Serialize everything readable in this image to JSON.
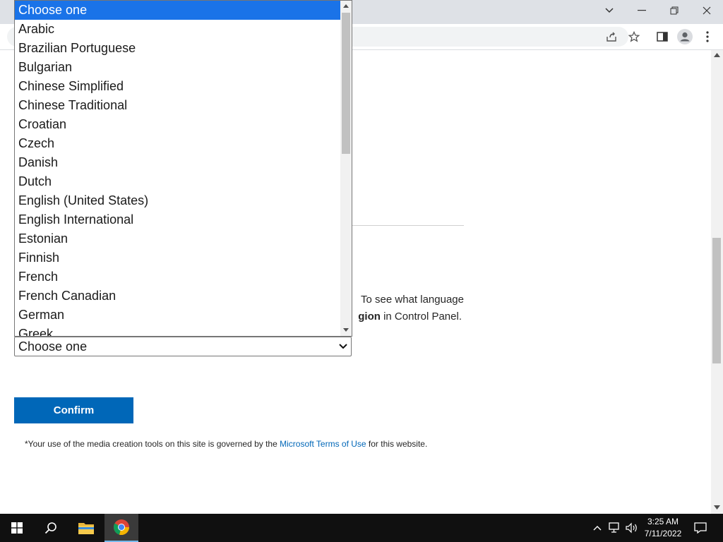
{
  "browser": {
    "window_controls": [
      "chevron-down",
      "minimize",
      "restore",
      "close"
    ]
  },
  "page": {
    "info_line1": "To see what language",
    "info_line2_bold": "gion",
    "info_line2_rest": " in Control Panel.",
    "select_value": "Choose one",
    "confirm_label": "Confirm",
    "terms_prefix": "*Your use of the media creation tools on this site is governed by the ",
    "terms_link": "Microsoft Terms of Use",
    "terms_suffix": " for this website."
  },
  "dropdown": {
    "options": [
      "Choose one",
      "Arabic",
      "Brazilian Portuguese",
      "Bulgarian",
      "Chinese Simplified",
      "Chinese Traditional",
      "Croatian",
      "Czech",
      "Danish",
      "Dutch",
      "English (United States)",
      "English International",
      "Estonian",
      "Finnish",
      "French",
      "French Canadian",
      "German",
      "Greek"
    ],
    "selected_index": 0
  },
  "taskbar": {
    "time": "3:25 AM",
    "date": "7/11/2022"
  },
  "colors": {
    "accent": "#0067b8",
    "selection": "#1a73e8"
  }
}
